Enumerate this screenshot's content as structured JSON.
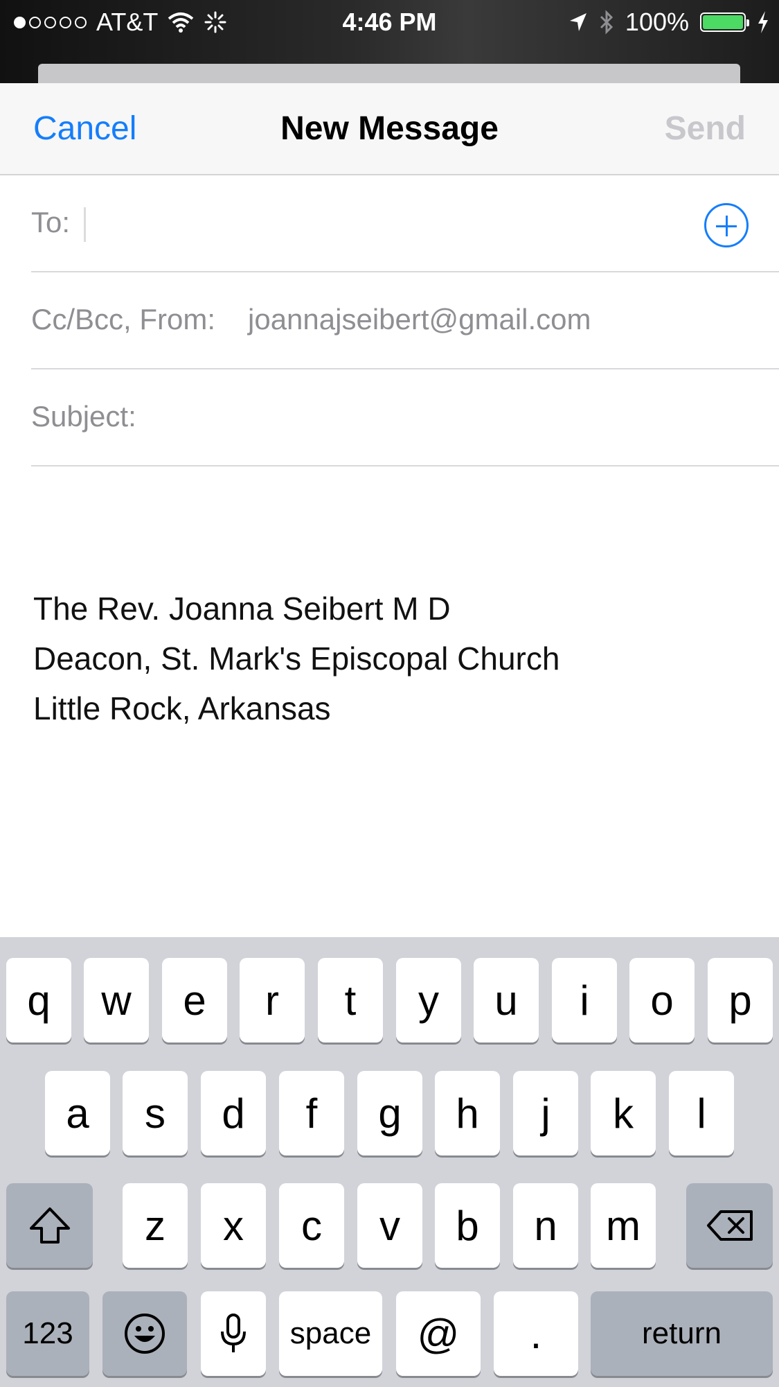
{
  "status_bar": {
    "carrier": "AT&T",
    "time": "4:46 PM",
    "battery": "100%",
    "battery_color": "#4cd964"
  },
  "nav": {
    "cancel": "Cancel",
    "title": "New Message",
    "send": "Send"
  },
  "fields": {
    "to_label": "To:",
    "cc_label": "Cc/Bcc, From:",
    "from_value": "joannajseibert@gmail.com",
    "subject_label": "Subject:"
  },
  "body": {
    "lines": [
      "The Rev. Joanna Seibert M D",
      "Deacon, St. Mark's Episcopal Church",
      "Little Rock, Arkansas"
    ]
  },
  "keyboard": {
    "row1": [
      "q",
      "w",
      "e",
      "r",
      "t",
      "y",
      "u",
      "i",
      "o",
      "p"
    ],
    "row2": [
      "a",
      "s",
      "d",
      "f",
      "g",
      "h",
      "j",
      "k",
      "l"
    ],
    "row3": [
      "z",
      "x",
      "c",
      "v",
      "b",
      "n",
      "m"
    ],
    "numbers": "123",
    "space": "space",
    "at": "@",
    "period": ".",
    "return": "return"
  },
  "colors": {
    "accent": "#157efb",
    "disabled": "#c7c7cc",
    "placeholder": "#8e8e93"
  }
}
